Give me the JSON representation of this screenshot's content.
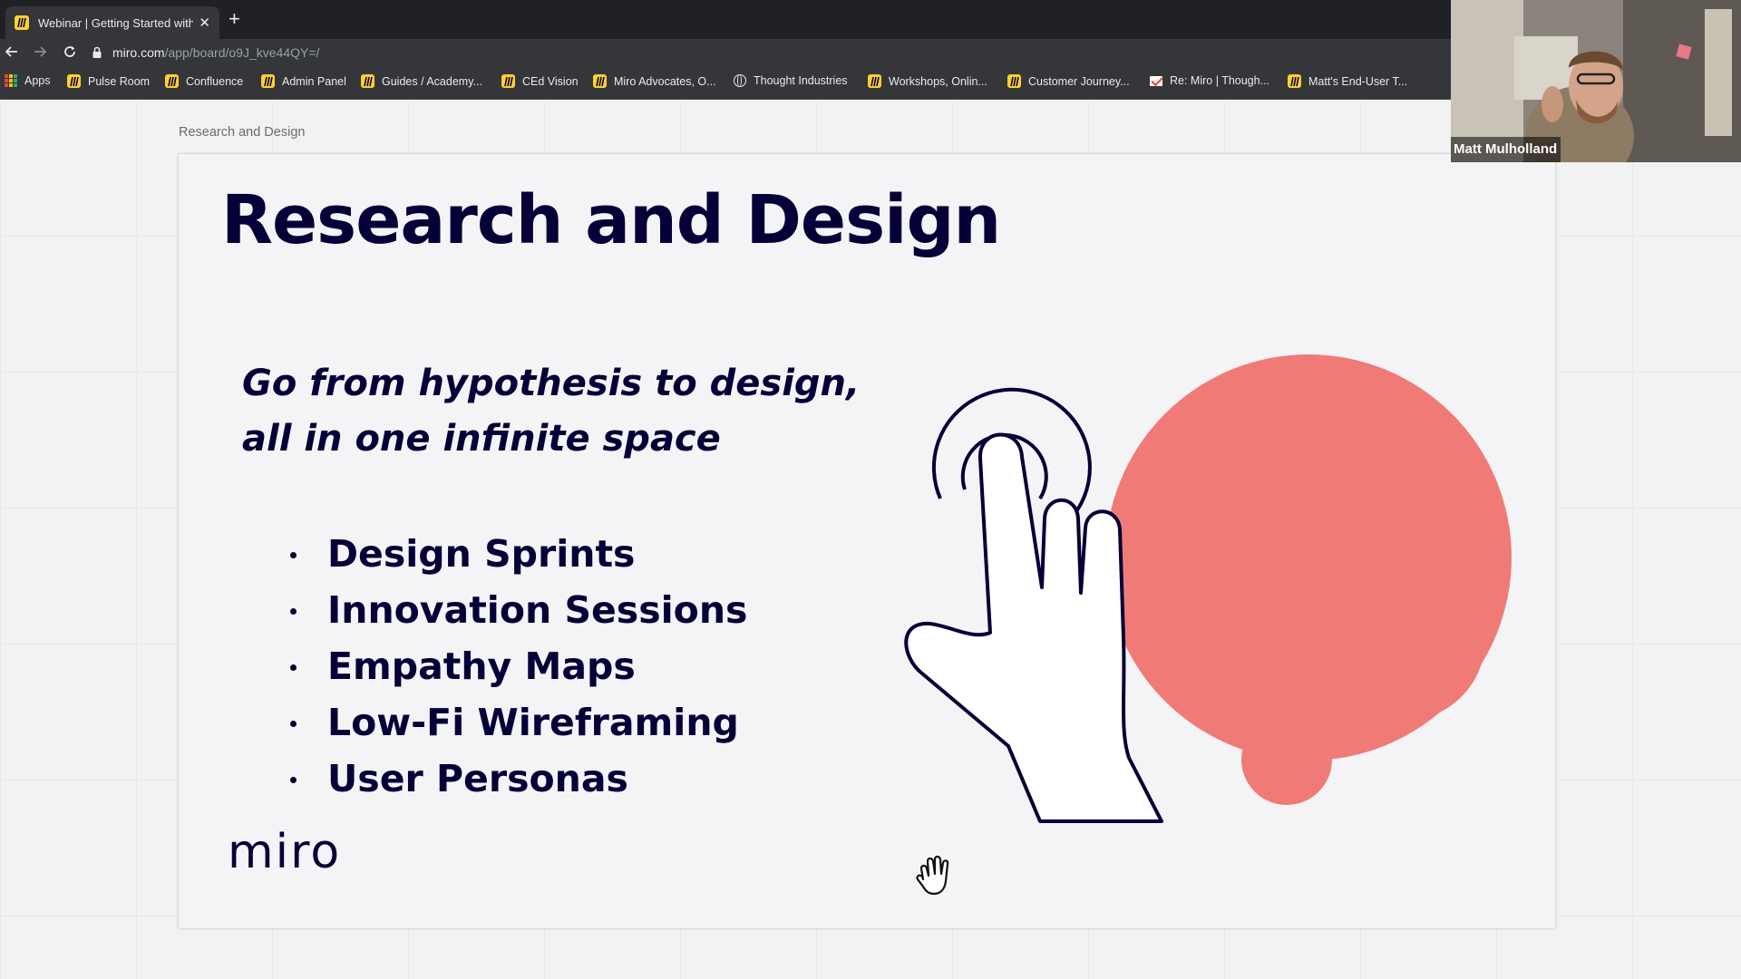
{
  "browser": {
    "tab_title": "Webinar | Getting Started with",
    "url_host": "miro.com",
    "url_path": "/app/board/o9J_kve44QY=/",
    "bookmarks": [
      {
        "label": "Apps",
        "icon": "apps-grid-icon"
      },
      {
        "label": "Pulse Room",
        "icon": "miro-icon"
      },
      {
        "label": "Confluence",
        "icon": "miro-icon"
      },
      {
        "label": "Admin Panel",
        "icon": "miro-icon"
      },
      {
        "label": "Guides / Academy...",
        "icon": "miro-icon"
      },
      {
        "label": "CEd Vision",
        "icon": "miro-icon"
      },
      {
        "label": "Miro Advocates, O...",
        "icon": "miro-icon"
      },
      {
        "label": "Thought Industries",
        "icon": "globe-icon"
      },
      {
        "label": "Workshops, Onlin...",
        "icon": "miro-icon"
      },
      {
        "label": "Customer Journey...",
        "icon": "miro-icon"
      },
      {
        "label": "Re: Miro | Though...",
        "icon": "gmail-icon"
      },
      {
        "label": "Matt's End-User T...",
        "icon": "miro-icon"
      }
    ]
  },
  "board": {
    "frame_label": "Research and Design",
    "slide": {
      "title": "Research and Design",
      "subtitle": "Go from hypothesis to design, all in one infinite space",
      "bullets": [
        "Design Sprints",
        "Innovation Sessions",
        "Empathy Maps",
        "Low-Fi Wireframing",
        "User Personas"
      ],
      "logo_text": "miro"
    }
  },
  "video": {
    "participant_name": "Matt Mulholland"
  },
  "colors": {
    "brand_yellow": "#ffd02f",
    "slide_navy": "#050038",
    "coral": "#f07b76",
    "chrome_dark": "#202124",
    "chrome_toolbar": "#35363a"
  }
}
